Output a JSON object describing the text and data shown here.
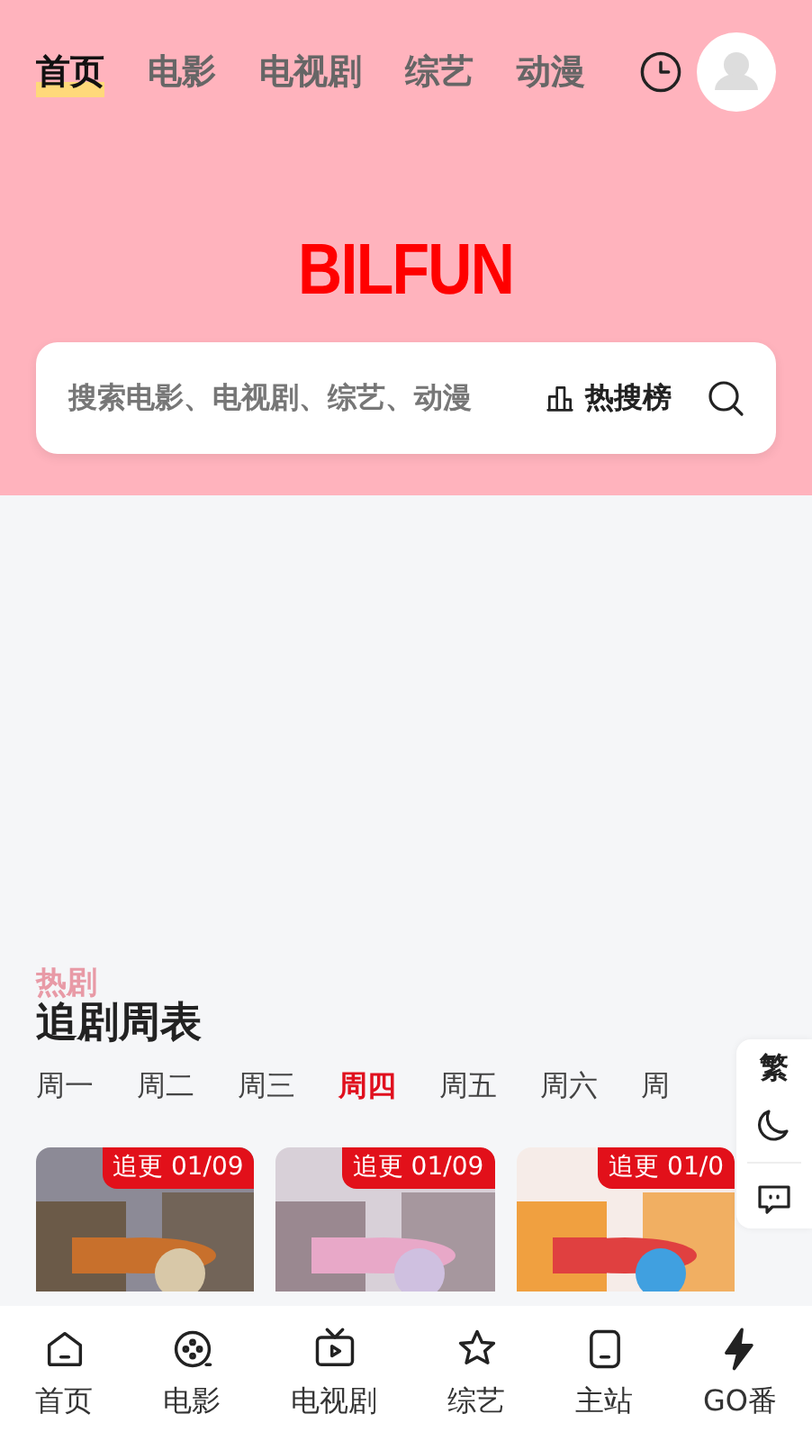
{
  "top_nav": [
    {
      "label": "首页",
      "selected": true
    },
    {
      "label": "电影",
      "selected": false
    },
    {
      "label": "电视剧",
      "selected": false
    },
    {
      "label": "综艺",
      "selected": false
    },
    {
      "label": "动漫",
      "selected": false
    }
  ],
  "logo": "BILFUN",
  "search": {
    "placeholder": "搜索电影、电视剧、综艺、动漫",
    "hot_label": "热搜榜"
  },
  "ghost_heading": "热剧",
  "schedule": {
    "title": "追剧周表",
    "days": [
      {
        "label": "周一",
        "selected": false
      },
      {
        "label": "周二",
        "selected": false
      },
      {
        "label": "周三",
        "selected": false
      },
      {
        "label": "周四",
        "selected": true
      },
      {
        "label": "周五",
        "selected": false
      },
      {
        "label": "周六",
        "selected": false
      },
      {
        "label": "周",
        "selected": false
      }
    ],
    "cards": [
      {
        "kind": "picture",
        "badge": "追更 01/09"
      },
      {
        "kind": "picture",
        "badge": "追更 01/09"
      },
      {
        "kind": "picture",
        "badge": "追更 01/0"
      }
    ]
  },
  "side_panel": {
    "traditional_label": "繁"
  },
  "bottom_nav": [
    {
      "label": "首页"
    },
    {
      "label": "电影"
    },
    {
      "label": "电视剧"
    },
    {
      "label": "综艺"
    },
    {
      "label": "主站"
    },
    {
      "label": "GO番"
    }
  ]
}
